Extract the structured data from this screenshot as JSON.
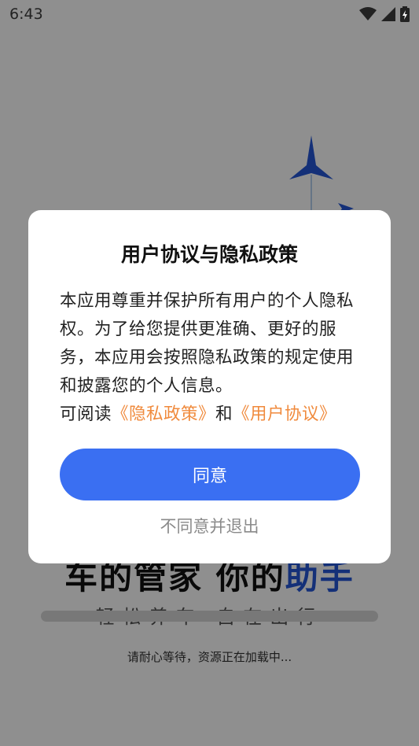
{
  "status_bar": {
    "time": "6:43",
    "icons": [
      "wifi-icon",
      "cellular-signal-icon",
      "battery-charging-icon"
    ]
  },
  "background": {
    "slogan_black": "车的管家 你的",
    "slogan_blue": "助手",
    "sub_slogan": "轻松养车 自在出行",
    "loading_text": "请耐心等待，资源正在加载中...",
    "accent_color": "#2457d6"
  },
  "dialog": {
    "title": "用户协议与隐私政策",
    "body": "本应用尊重并保护所有用户的个人隐私权。为了给您提供更准确、更好的服务，本应用会按照隐私政策的规定使用和披露您的个人信息。",
    "read_prefix": "可阅读",
    "privacy_link": "《隐私政策》",
    "and_text": "和",
    "user_agreement_link": "《用户协议》",
    "agree_label": "同意",
    "decline_label": "不同意并退出",
    "link_color": "#f08a3c",
    "button_color": "#3a6ff2"
  }
}
